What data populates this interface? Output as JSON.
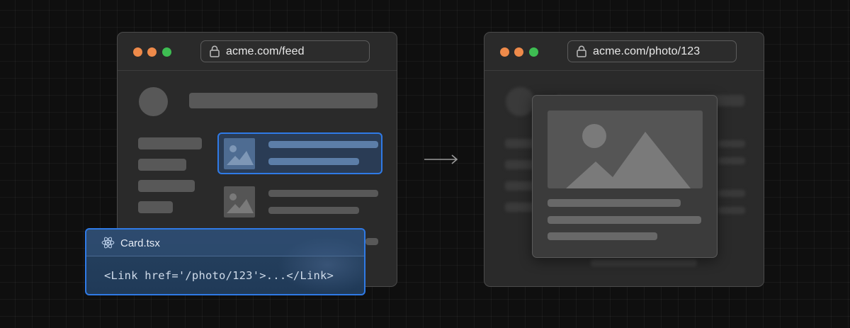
{
  "left_window": {
    "address": "acme.com/feed",
    "dots": [
      "#ee8a4a",
      "#ee8a4a",
      "#3ebd52"
    ]
  },
  "right_window": {
    "address": "acme.com/photo/123",
    "dots": [
      "#ee8a4a",
      "#ee8a4a",
      "#3ebd52"
    ]
  },
  "code_panel": {
    "file_name": "Card.tsx",
    "code": "<Link href='/photo/123'>...</Link>"
  },
  "colors": {
    "accent": "#2f7ae6",
    "background": "#0f0f0f",
    "window": "#2a2a2a",
    "placeholder": "#585858"
  },
  "icons": {
    "lock": "lock-icon",
    "image": "image-placeholder-icon",
    "react": "react-icon",
    "arrow": "arrow-right-icon"
  }
}
